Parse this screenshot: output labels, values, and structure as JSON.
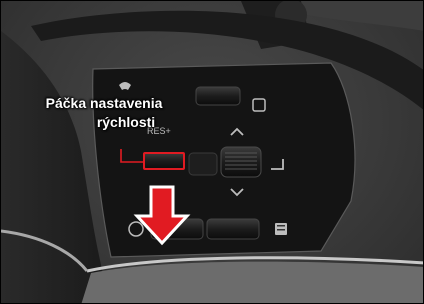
{
  "photo": {
    "subject": "Steering wheel spoke with cruise control switches",
    "callout_line1": "Páčka nastavenia",
    "callout_line2": "rýchlosti",
    "button_label_res": "RES+",
    "colors": {
      "highlight": "#e11b22",
      "arrow": "#e11b22",
      "spoke": "#141414",
      "trim": "#9a9a9a"
    },
    "icons": [
      "up-chevron-icon",
      "down-chevron-icon",
      "return-icon",
      "distance-icon",
      "lane-icon",
      "menu-icon",
      "phone-icon"
    ]
  }
}
